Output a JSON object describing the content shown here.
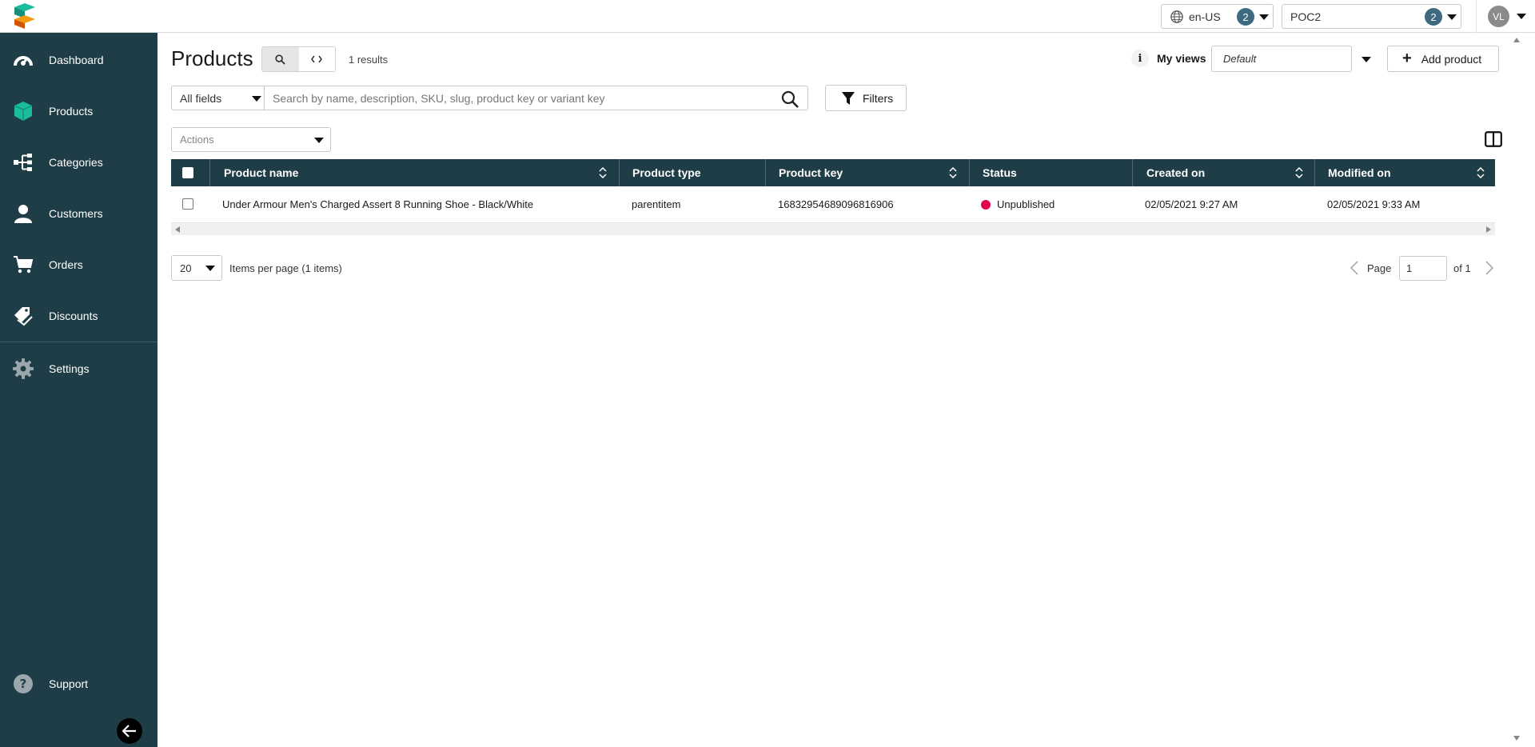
{
  "topbar": {
    "language": "en-US",
    "language_count": "2",
    "project": "POC2",
    "project_count": "2",
    "user_initials": "VL"
  },
  "sidebar": {
    "items": [
      {
        "label": "Dashboard",
        "icon": "gauge-icon"
      },
      {
        "label": "Products",
        "icon": "cube-icon"
      },
      {
        "label": "Categories",
        "icon": "tree-icon"
      },
      {
        "label": "Customers",
        "icon": "user-icon"
      },
      {
        "label": "Orders",
        "icon": "cart-icon"
      },
      {
        "label": "Discounts",
        "icon": "tag-icon"
      },
      {
        "label": "Settings",
        "icon": "gear-icon"
      },
      {
        "label": "Support",
        "icon": "help-icon"
      }
    ]
  },
  "header": {
    "title": "Products",
    "results": "1 results",
    "myviews_label": "My views",
    "views_selected": "Default",
    "add_product": "Add product"
  },
  "search": {
    "field_selected": "All fields",
    "placeholder": "Search by name, description, SKU, slug, product key or variant key",
    "filters_label": "Filters"
  },
  "actions": {
    "placeholder": "Actions"
  },
  "table": {
    "columns": [
      "Product name",
      "Product type",
      "Product key",
      "Status",
      "Created on",
      "Modified on"
    ],
    "rows": [
      {
        "name": "Under Armour Men's Charged Assert 8 Running Shoe - Black/White",
        "type": "parentitem",
        "key": "16832954689096816906",
        "status": "Unpublished",
        "created": "02/05/2021 9:27 AM",
        "modified": "02/05/2021 9:33 AM"
      }
    ]
  },
  "pagination": {
    "per_page": "20",
    "per_page_label": "Items per page (1 items)",
    "page_label": "Page",
    "page_value": "1",
    "of_label": "of 1"
  },
  "colors": {
    "sidebar": "#1f3d47",
    "accent": "#1abc9c",
    "unpublished": "#e3004d"
  }
}
